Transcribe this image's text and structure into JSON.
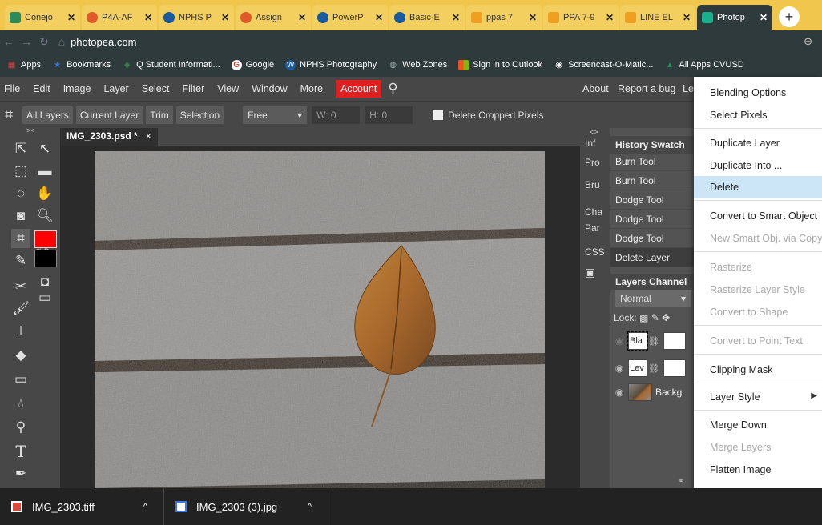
{
  "browser": {
    "tabs": [
      {
        "label": "Conejo",
        "color": "#2a8c5a"
      },
      {
        "label": "P4A-AF",
        "color": "#e05a2a"
      },
      {
        "label": "NPHS P",
        "color": "#1a5aa0"
      },
      {
        "label": "Assign",
        "color": "#e05a2a"
      },
      {
        "label": "PowerP",
        "color": "#1a5aa0"
      },
      {
        "label": "Basic-E",
        "color": "#1a5aa0"
      },
      {
        "label": "ppas 7",
        "color": "#f0a020"
      },
      {
        "label": "PPA 7-9",
        "color": "#f0a020"
      },
      {
        "label": "LINE EL",
        "color": "#f0a020"
      },
      {
        "label": "Photop",
        "color": "#19b08c",
        "active": true
      }
    ],
    "new_tab": "+",
    "url": "photopea.com",
    "bookmarks": [
      {
        "label": "Apps",
        "color": "#e04040"
      },
      {
        "label": "Bookmarks",
        "color": "#3b78e7"
      },
      {
        "label": "Q Student Informati...",
        "color": "#3a7a4a"
      },
      {
        "label": "Google",
        "color": "#ffffff"
      },
      {
        "label": "NPHS Photography",
        "color": "#1a5aa0"
      },
      {
        "label": "Web Zones",
        "color": "#8a9a9a"
      },
      {
        "label": "Sign in to Outlook",
        "color": "#f25022"
      },
      {
        "label": "Screencast-O-Matic...",
        "color": "#2b5aa8"
      },
      {
        "label": "All Apps CVUSD",
        "color": "#2a8c5a"
      }
    ]
  },
  "menu": {
    "items": [
      "File",
      "Edit",
      "Image",
      "Layer",
      "Select",
      "Filter",
      "View",
      "Window",
      "More"
    ],
    "account": "Account",
    "right_items": [
      "About",
      "Report a bug",
      "Le"
    ]
  },
  "options": {
    "buttons": [
      "All Layers",
      "Current Layer",
      "Trim",
      "Selection"
    ],
    "ratio": "Free",
    "w_label": "W: 0",
    "h_label": "H: 0",
    "delete_cropped": "Delete Cropped Pixels"
  },
  "document": {
    "tab": "IMG_2303.psd *",
    "close": "×"
  },
  "side_panel": [
    "Inf",
    "Pro",
    "Bru",
    "Cha",
    "Par",
    "CSS"
  ],
  "history": {
    "tabs": "History Swatch",
    "items": [
      "Burn Tool",
      "Burn Tool",
      "Dodge Tool",
      "Dodge Tool",
      "Dodge Tool",
      "Delete Layer"
    ]
  },
  "layers": {
    "tabs": "Layers Channel",
    "blend_mode": "Normal",
    "lock_label": "Lock:",
    "items": [
      {
        "name": "Bla"
      },
      {
        "name": "Lev"
      },
      {
        "name": "Backg"
      }
    ]
  },
  "context_menu": {
    "items": [
      {
        "label": "Blending Options",
        "state": "normal"
      },
      {
        "label": "Select Pixels",
        "state": "normal"
      },
      {
        "label": "Duplicate Layer",
        "state": "normal"
      },
      {
        "label": "Duplicate Into ...",
        "state": "normal"
      },
      {
        "label": "Delete",
        "state": "highlighted"
      },
      {
        "label": "Convert to Smart Object",
        "state": "normal"
      },
      {
        "label": "New Smart Obj. via Copy",
        "state": "disabled"
      },
      {
        "label": "Rasterize",
        "state": "disabled"
      },
      {
        "label": "Rasterize Layer Style",
        "state": "disabled"
      },
      {
        "label": "Convert to Shape",
        "state": "disabled"
      },
      {
        "label": "Convert to Point Text",
        "state": "disabled"
      },
      {
        "label": "Clipping Mask",
        "state": "normal"
      },
      {
        "label": "Layer Style",
        "state": "normal",
        "submenu": "▶"
      },
      {
        "label": "Merge Down",
        "state": "normal"
      },
      {
        "label": "Merge Layers",
        "state": "disabled"
      },
      {
        "label": "Flatten Image",
        "state": "normal"
      }
    ]
  },
  "downloads": [
    {
      "name": "IMG_2303.tiff",
      "caret": "^"
    },
    {
      "name": "IMG_2303 (3).jpg",
      "caret": "^"
    }
  ],
  "colors": {
    "foreground": "#ff0000",
    "background": "#000000",
    "account": "#e02020",
    "highlight": "#cde6f7"
  }
}
